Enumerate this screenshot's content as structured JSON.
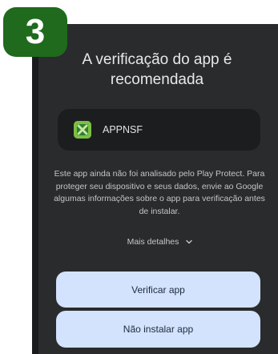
{
  "step": {
    "number": "3"
  },
  "dialog": {
    "title": "A verificação do app é recomendada",
    "app": {
      "name": "APPNSF",
      "icon": "app-logo-icon"
    },
    "description": "Este app ainda não foi analisado pelo Play Protect. Para proteger seu dispositivo e seus dados, envie ao Google algumas informações sobre o app para verificação antes de instalar.",
    "more_details": {
      "label": "Mais detalhes",
      "icon": "chevron-down-icon"
    },
    "buttons": {
      "verify": "Verificar app",
      "dont_install": "Não instalar app"
    }
  },
  "colors": {
    "dialog_bg": "#2a2b2d",
    "card_bg": "#1c1d1f",
    "button_bg": "#d3e3fd",
    "badge_bg": "#1f6a1c"
  }
}
